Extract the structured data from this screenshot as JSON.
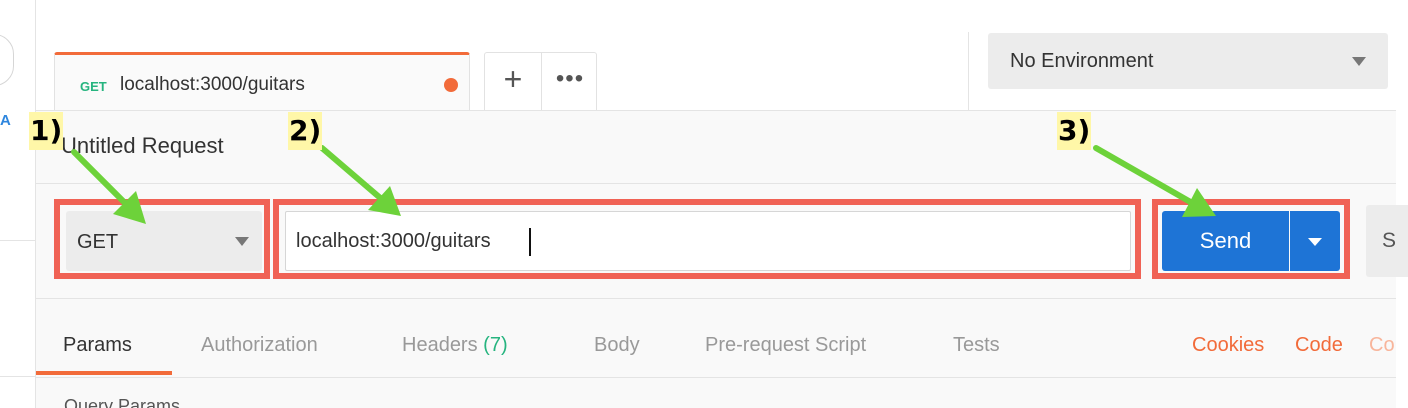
{
  "sidebar": {
    "letter": "A"
  },
  "tab": {
    "method": "GET",
    "title": "localhost:3000/guitars",
    "add_label": "+",
    "more_label": "•••"
  },
  "environment": {
    "selected": "No Environment"
  },
  "request": {
    "name": "Untitled Request",
    "method": "GET",
    "url": "localhost:3000/guitars",
    "send_label": "Send",
    "save_label": "S"
  },
  "subtabs": {
    "params": "Params",
    "authorization": "Authorization",
    "headers": "Headers",
    "headers_count": "(7)",
    "body": "Body",
    "prerequest": "Pre-request Script",
    "tests": "Tests"
  },
  "links": {
    "cookies": "Cookies",
    "code": "Code",
    "comments": "Co"
  },
  "section": {
    "query_params": "Query Params"
  },
  "annotations": {
    "step1": "1)",
    "step2": "2)",
    "step3": "3)"
  },
  "colors": {
    "accent": "#f26b3a",
    "get_green": "#26b47f",
    "send_blue": "#1e74d6",
    "highlight_red": "#f06255",
    "arrow_green": "#6dd23a"
  }
}
